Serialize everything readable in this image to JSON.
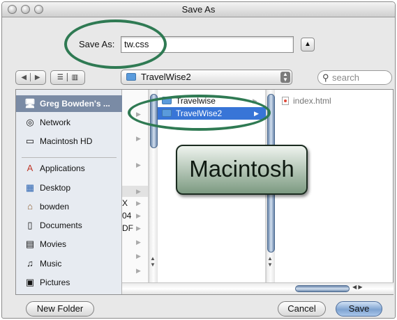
{
  "window": {
    "title": "Save As"
  },
  "save": {
    "label": "Save As:",
    "filename": "tw.css"
  },
  "toolbar": {
    "location": "TravelWise2",
    "search_placeholder": "search"
  },
  "sidebar": {
    "items": [
      {
        "label": "Greg Bowden's ...",
        "icon": "computer-icon"
      },
      {
        "label": "Network",
        "icon": "network-icon"
      },
      {
        "label": "Macintosh HD",
        "icon": "hard-drive-icon"
      },
      {
        "label": "Applications",
        "icon": "applications-icon"
      },
      {
        "label": "Desktop",
        "icon": "desktop-icon"
      },
      {
        "label": "bowden",
        "icon": "home-icon"
      },
      {
        "label": "Documents",
        "icon": "documents-icon"
      },
      {
        "label": "Movies",
        "icon": "movies-icon"
      },
      {
        "label": "Music",
        "icon": "music-icon"
      },
      {
        "label": "Pictures",
        "icon": "pictures-icon"
      }
    ]
  },
  "columns": {
    "partial": [
      "X",
      "04",
      "DF"
    ],
    "folders": [
      "Travelwise",
      "TravelWise2"
    ],
    "files": [
      "index.html"
    ]
  },
  "overlay": {
    "text": "Macintosh"
  },
  "buttons": {
    "new_folder": "New Folder",
    "cancel": "Cancel",
    "save": "Save"
  },
  "colors": {
    "highlight_ring": "#2f7a53",
    "selection": "#3875d7",
    "sidebar_selection": "#7a8ba5"
  }
}
